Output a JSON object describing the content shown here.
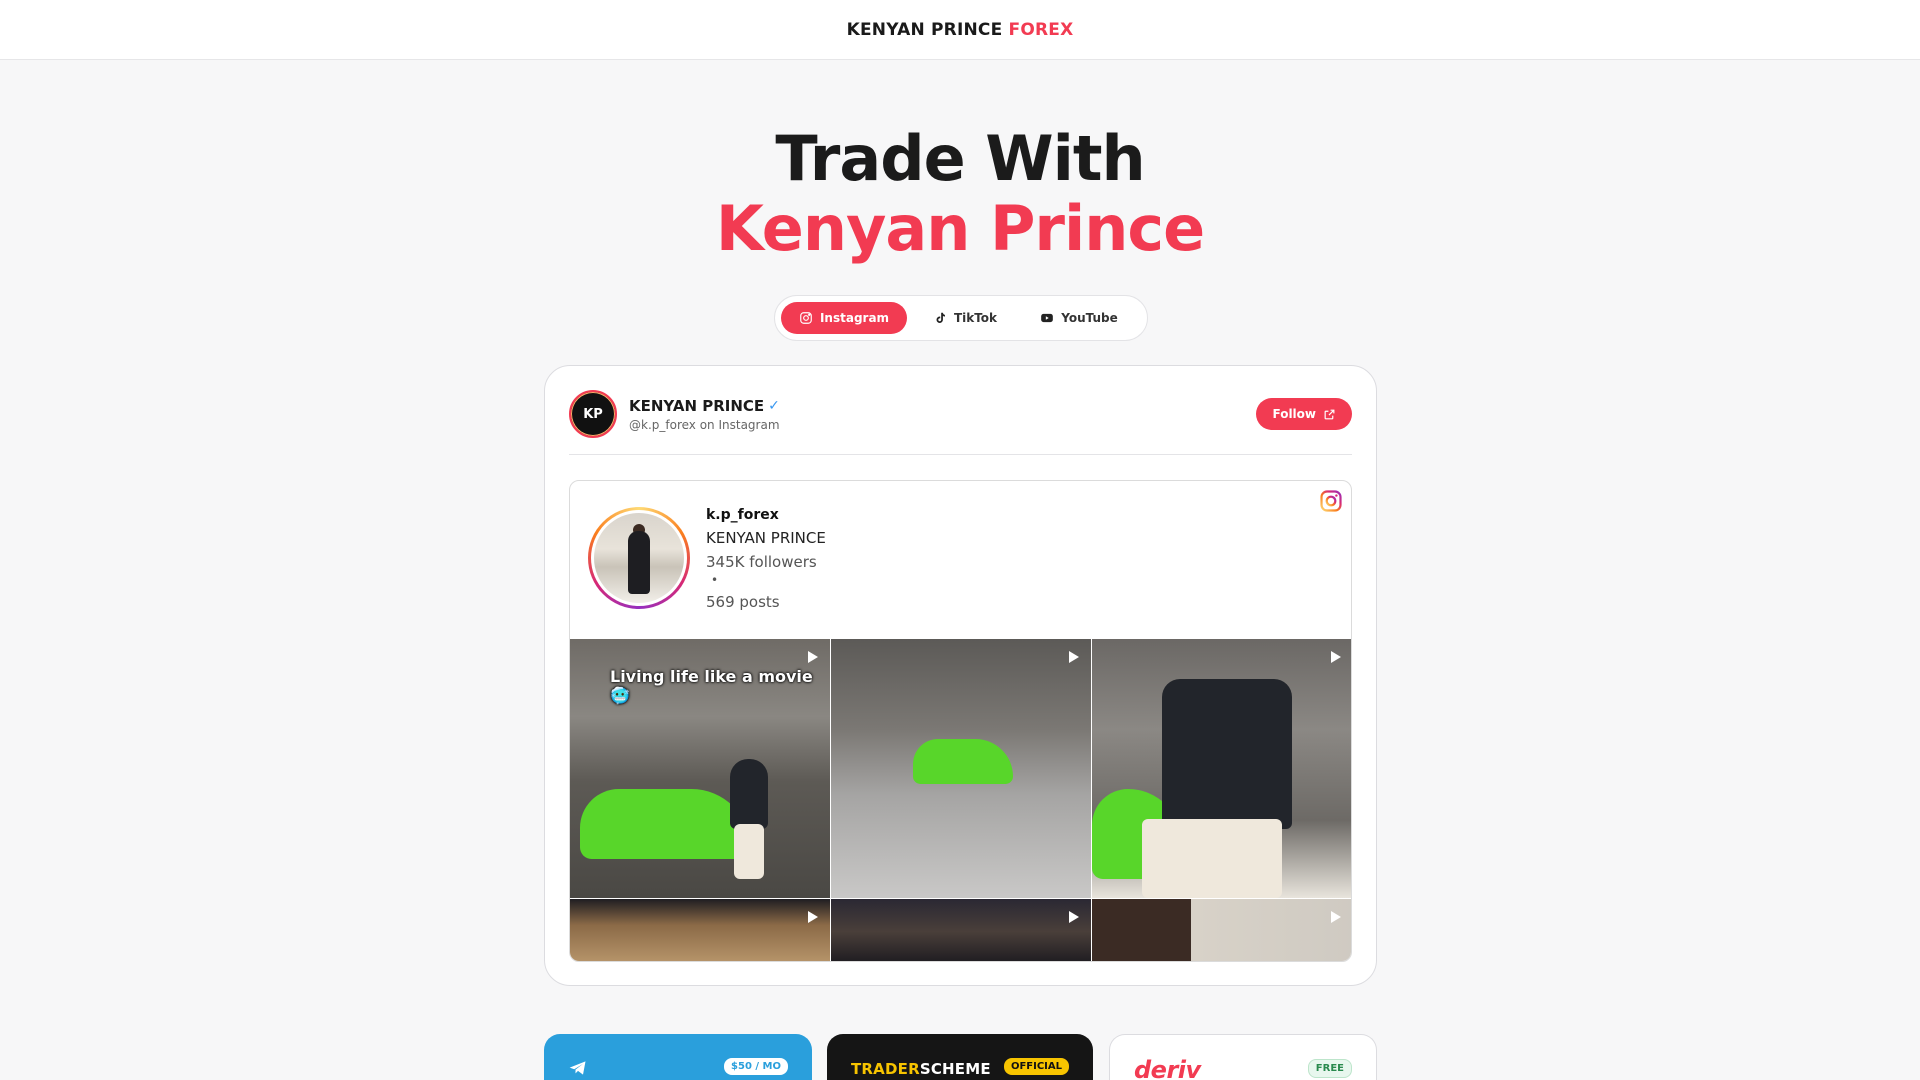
{
  "header": {
    "brand_main": "KENYAN PRINCE",
    "brand_accent": "FOREX"
  },
  "hero": {
    "line1": "Trade With",
    "line2": "Kenyan Prince"
  },
  "tabs": [
    {
      "label": "Instagram",
      "icon": "instagram-icon",
      "active": true
    },
    {
      "label": "TikTok",
      "icon": "tiktok-icon",
      "active": false
    },
    {
      "label": "YouTube",
      "icon": "youtube-icon",
      "active": false
    }
  ],
  "card": {
    "avatar_initials": "KP",
    "name": "KENYAN PRINCE",
    "verified": "✓",
    "handle": "@k.p_forex on Instagram",
    "follow_label": "Follow"
  },
  "instagram": {
    "username": "k.p_forex",
    "full_name": "KENYAN PRINCE",
    "followers": "345K followers",
    "separator": "•",
    "posts": "569 posts",
    "first_caption": "Living life like a movie🥶"
  },
  "promos": [
    {
      "badge": "$50 / MO",
      "icon": "telegram-icon"
    },
    {
      "brand_a": "TRADER",
      "brand_b": "SCHEME",
      "badge": "OFFICIAL"
    },
    {
      "brand": "deriv",
      "badge": "FREE"
    }
  ],
  "colors": {
    "accent": "#f23b52",
    "telegram": "#2a9fdc",
    "gold": "#f7c400"
  }
}
